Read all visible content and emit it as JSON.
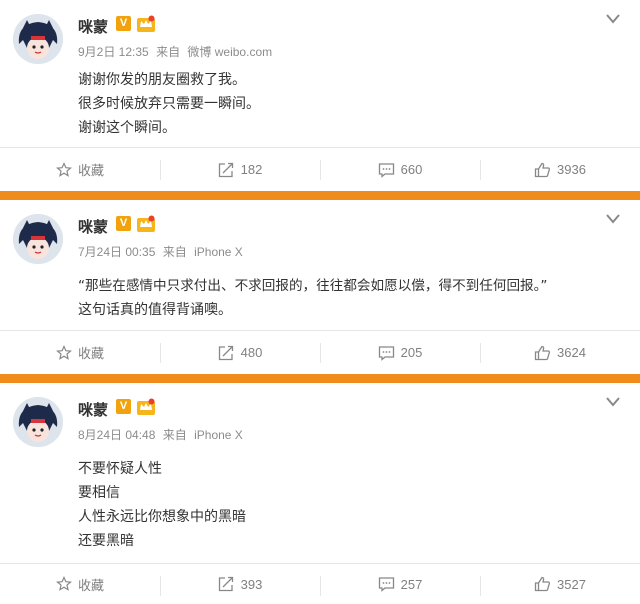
{
  "posts": [
    {
      "author": "咪蒙",
      "verified_badge": "V",
      "date": "9月2日 12:35",
      "source_prefix": "来自",
      "source": "微博 weibo.com",
      "lines": [
        "谢谢你发的朋友圈救了我。",
        "很多时候放弃只需要一瞬间。",
        "谢谢这个瞬间。"
      ],
      "actions": {
        "favorite": "收藏",
        "repost": "182",
        "comment": "660",
        "like": "3936"
      }
    },
    {
      "author": "咪蒙",
      "verified_badge": "V",
      "date": "7月24日 00:35",
      "source_prefix": "来自",
      "source": "iPhone X",
      "lines": [
        "“那些在感情中只求付出、不求回报的，往往都会如愿以偿，得不到任何回报。”",
        "这句话真的值得背诵噢。"
      ],
      "actions": {
        "favorite": "收藏",
        "repost": "480",
        "comment": "205",
        "like": "3624"
      }
    },
    {
      "author": "咪蒙",
      "verified_badge": "V",
      "date": "8月24日 04:48",
      "source_prefix": "来自",
      "source": "iPhone X",
      "lines": [
        "不要怀疑人性",
        "要相信",
        "人性永远比你想象中的黑暗",
        "还要黑暗"
      ],
      "actions": {
        "favorite": "收藏",
        "repost": "393",
        "comment": "257",
        "like": "3527"
      }
    }
  ],
  "colors": {
    "separator": "#f08c1c",
    "badge": "#f2a20c",
    "text": "#333333",
    "meta": "#8c8c8c"
  }
}
